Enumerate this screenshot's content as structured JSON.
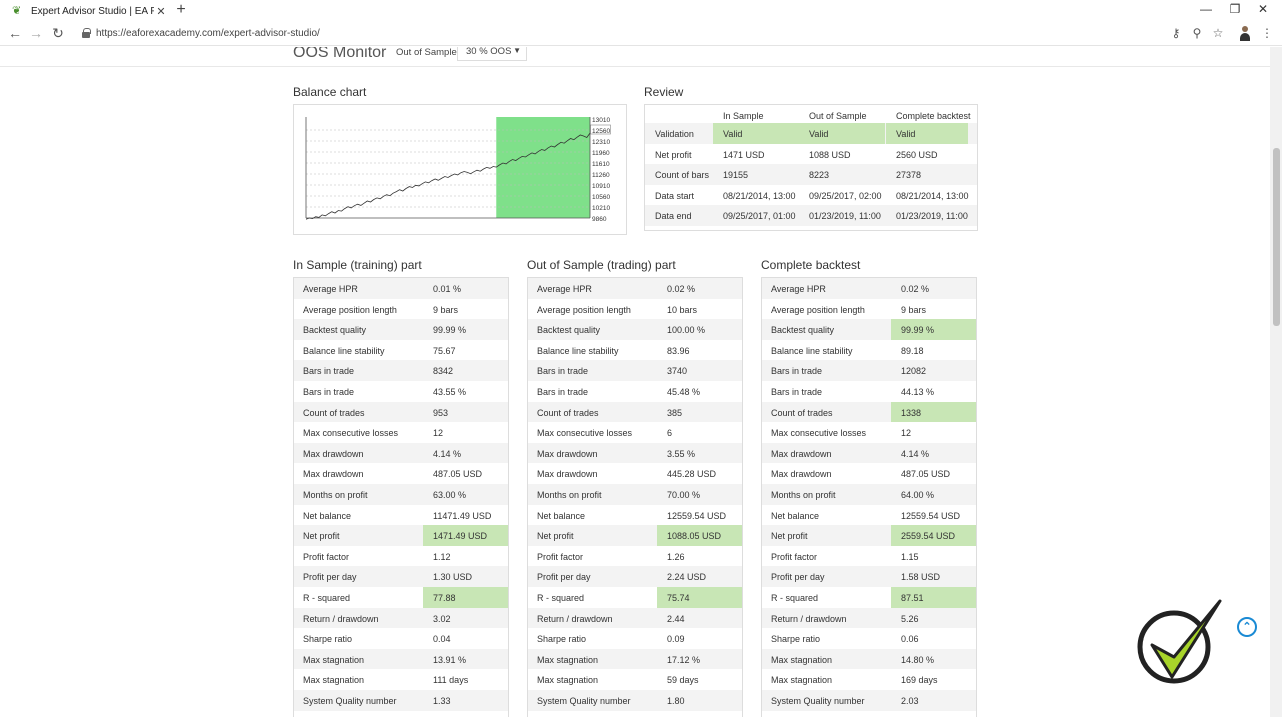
{
  "browser": {
    "tab_title": "Expert Advisor Studio | EA Forex",
    "url": "https://eaforexacademy.com/expert-advisor-studio/",
    "new_tab": "+",
    "close_tab": "✕",
    "minimize": "—",
    "restore": "❐",
    "close_window": "✕"
  },
  "oos": {
    "title": "OOS Monitor",
    "label": "Out of Sample",
    "selected": "30 % OOS"
  },
  "balance_chart": {
    "title": "Balance chart",
    "chart_data": {
      "type": "line",
      "series": [
        {
          "values": [
            9820,
            9860,
            9840,
            9900,
            9880,
            9960,
            9930,
            10000,
            10060,
            10020,
            10100,
            10080,
            10160,
            10220,
            10180,
            10250,
            10300,
            10260,
            10330,
            10400,
            10370,
            10450,
            10500,
            10470,
            10550,
            10600,
            10570,
            10650,
            10700,
            10760,
            10720,
            10800,
            10860,
            10830,
            10900,
            10880,
            10950,
            11010,
            10980,
            11050,
            11100,
            11060,
            11120,
            11180,
            11150,
            11210,
            11260,
            11230,
            11300,
            11340,
            11310,
            11270,
            11330,
            11380,
            11350,
            11420,
            11470,
            11440,
            11500,
            11480,
            11550,
            11610,
            11580,
            11660,
            11720,
            11690,
            11760,
            11820,
            11800,
            11870,
            11930,
            11900,
            11980,
            12040,
            12010,
            12090,
            12150,
            12120,
            12200,
            12270,
            12240,
            12320,
            12390,
            12350,
            12430,
            12500,
            12470,
            12420,
            12560
          ]
        }
      ],
      "oos_start_fraction": 0.67,
      "ylim": [
        9860,
        13010
      ],
      "ticks": [
        "13010",
        "12560",
        "12310",
        "11960",
        "11610",
        "11260",
        "10910",
        "10560",
        "10210",
        "9860"
      ],
      "highlight_tick": "12560"
    }
  },
  "review": {
    "title": "Review",
    "headers": [
      "",
      "In Sample",
      "Out of Sample",
      "Complete backtest"
    ],
    "rows": [
      [
        "Validation",
        "Valid",
        "Valid",
        "Valid"
      ],
      [
        "Net profit",
        "1471 USD",
        "1088 USD",
        "2560 USD"
      ],
      [
        "Count of bars",
        "19155",
        "8223",
        "27378"
      ],
      [
        "Data start",
        "08/21/2014, 13:00",
        "09/25/2017, 02:00",
        "08/21/2014, 13:00"
      ],
      [
        "Data end",
        "09/25/2017, 01:00",
        "01/23/2019, 11:00",
        "01/23/2019, 11:00"
      ]
    ]
  },
  "tables": [
    {
      "title": "In Sample (training) part",
      "rows": [
        [
          "Average HPR",
          "0.01 %",
          false
        ],
        [
          "Average position length",
          "9 bars",
          false
        ],
        [
          "Backtest quality",
          "99.99 %",
          false
        ],
        [
          "Balance line stability",
          "75.67",
          false
        ],
        [
          "Bars in trade",
          "8342",
          false
        ],
        [
          "Bars in trade",
          "43.55 %",
          false
        ],
        [
          "Count of trades",
          "953",
          false
        ],
        [
          "Max consecutive losses",
          "12",
          false
        ],
        [
          "Max drawdown",
          "4.14 %",
          false
        ],
        [
          "Max drawdown",
          "487.05 USD",
          false
        ],
        [
          "Months on profit",
          "63.00 %",
          false
        ],
        [
          "Net balance",
          "11471.49 USD",
          false
        ],
        [
          "Net profit",
          "1471.49 USD",
          true
        ],
        [
          "Profit factor",
          "1.12",
          false
        ],
        [
          "Profit per day",
          "1.30 USD",
          false
        ],
        [
          "R - squared",
          "77.88",
          true
        ],
        [
          "Return / drawdown",
          "3.02",
          false
        ],
        [
          "Sharpe ratio",
          "0.04",
          false
        ],
        [
          "Max stagnation",
          "13.91 %",
          false
        ],
        [
          "Max stagnation",
          "111 days",
          false
        ],
        [
          "System Quality number",
          "1.33",
          false
        ]
      ]
    },
    {
      "title": "Out of Sample (trading) part",
      "rows": [
        [
          "Average HPR",
          "0.02 %",
          false
        ],
        [
          "Average position length",
          "10 bars",
          false
        ],
        [
          "Backtest quality",
          "100.00 %",
          false
        ],
        [
          "Balance line stability",
          "83.96",
          false
        ],
        [
          "Bars in trade",
          "3740",
          false
        ],
        [
          "Bars in trade",
          "45.48 %",
          false
        ],
        [
          "Count of trades",
          "385",
          false
        ],
        [
          "Max consecutive losses",
          "6",
          false
        ],
        [
          "Max drawdown",
          "3.55 %",
          false
        ],
        [
          "Max drawdown",
          "445.28 USD",
          false
        ],
        [
          "Months on profit",
          "70.00 %",
          false
        ],
        [
          "Net balance",
          "12559.54 USD",
          false
        ],
        [
          "Net profit",
          "1088.05 USD",
          true
        ],
        [
          "Profit factor",
          "1.26",
          false
        ],
        [
          "Profit per day",
          "2.24 USD",
          false
        ],
        [
          "R - squared",
          "75.74",
          true
        ],
        [
          "Return / drawdown",
          "2.44",
          false
        ],
        [
          "Sharpe ratio",
          "0.09",
          false
        ],
        [
          "Max stagnation",
          "17.12 %",
          false
        ],
        [
          "Max stagnation",
          "59 days",
          false
        ],
        [
          "System Quality number",
          "1.80",
          false
        ]
      ]
    },
    {
      "title": "Complete backtest",
      "rows": [
        [
          "Average HPR",
          "0.02 %",
          false
        ],
        [
          "Average position length",
          "9 bars",
          false
        ],
        [
          "Backtest quality",
          "99.99 %",
          true
        ],
        [
          "Balance line stability",
          "89.18",
          false
        ],
        [
          "Bars in trade",
          "12082",
          false
        ],
        [
          "Bars in trade",
          "44.13 %",
          false
        ],
        [
          "Count of trades",
          "1338",
          true
        ],
        [
          "Max consecutive losses",
          "12",
          false
        ],
        [
          "Max drawdown",
          "4.14 %",
          false
        ],
        [
          "Max drawdown",
          "487.05 USD",
          false
        ],
        [
          "Months on profit",
          "64.00 %",
          false
        ],
        [
          "Net balance",
          "12559.54 USD",
          false
        ],
        [
          "Net profit",
          "2559.54 USD",
          true
        ],
        [
          "Profit factor",
          "1.15",
          false
        ],
        [
          "Profit per day",
          "1.58 USD",
          false
        ],
        [
          "R - squared",
          "87.51",
          true
        ],
        [
          "Return / drawdown",
          "5.26",
          false
        ],
        [
          "Sharpe ratio",
          "0.06",
          false
        ],
        [
          "Max stagnation",
          "14.80 %",
          false
        ],
        [
          "Max stagnation",
          "169 days",
          false
        ],
        [
          "System Quality number",
          "2.03",
          false
        ]
      ]
    }
  ],
  "colors": {
    "highlight": "#c8e6b5",
    "oos_area": "#7fe08a",
    "accent": "#1a8ad4",
    "logo_green": "#a8d42a"
  },
  "icons": {
    "favicon": "leaf-icon",
    "back": "arrow-left-icon",
    "forward": "arrow-right-icon",
    "reload": "reload-icon",
    "scroll_top": "chevron-up-icon"
  }
}
